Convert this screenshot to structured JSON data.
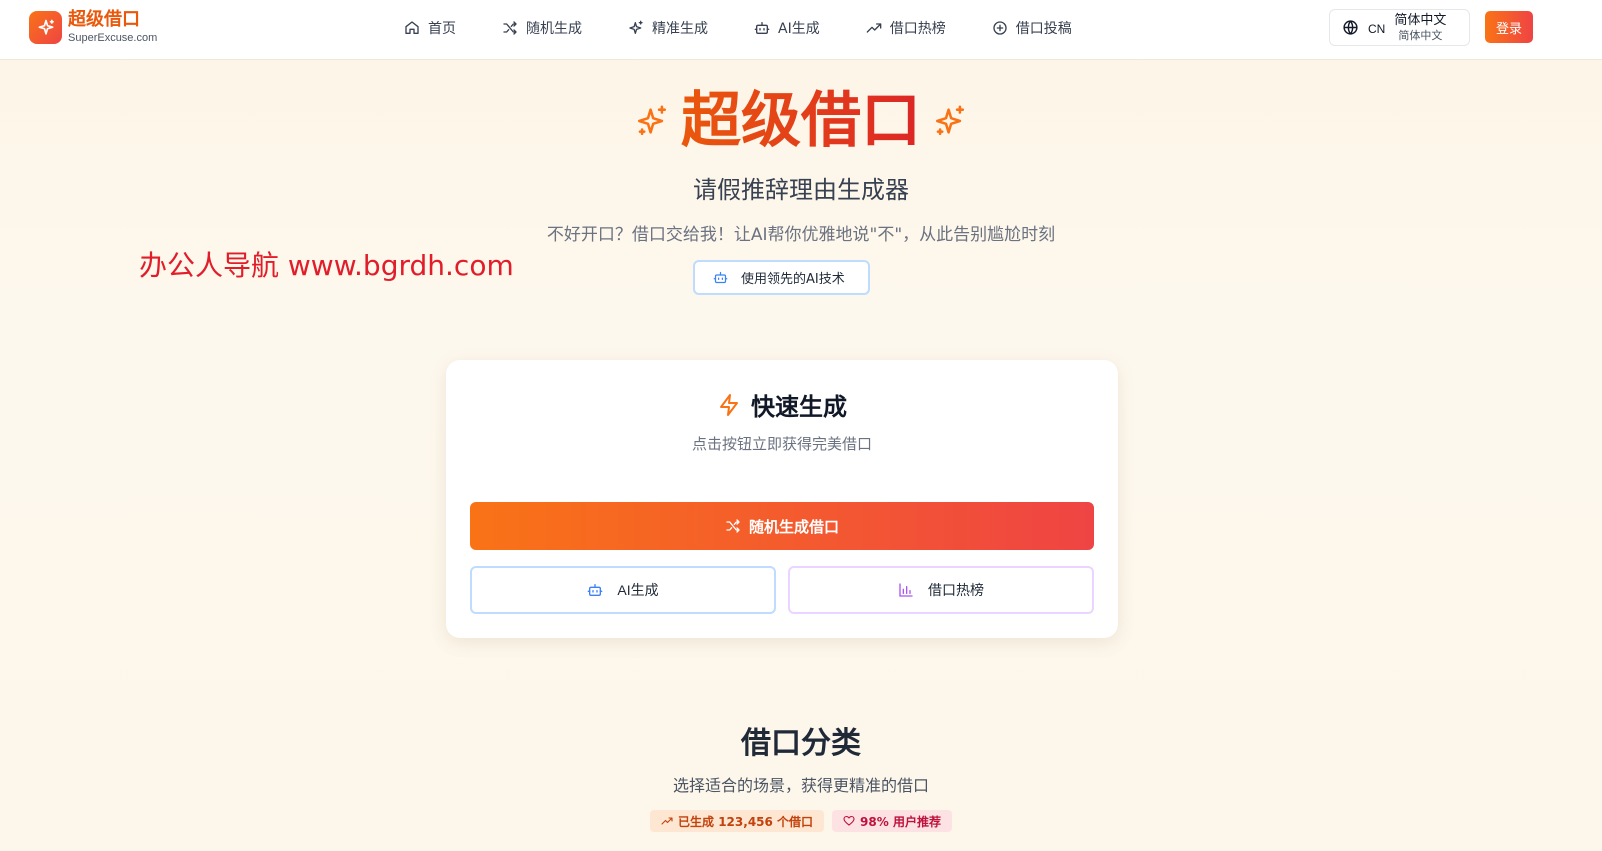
{
  "header": {
    "logo_title": "超级借口",
    "logo_sub": "SuperExcuse.com",
    "nav": [
      {
        "label": "首页",
        "icon": "home-icon"
      },
      {
        "label": "随机生成",
        "icon": "shuffle-icon"
      },
      {
        "label": "精准生成",
        "icon": "sparkles-icon"
      },
      {
        "label": "AI生成",
        "icon": "bot-icon"
      },
      {
        "label": "借口热榜",
        "icon": "trending-up-icon"
      },
      {
        "label": "借口投稿",
        "icon": "plus-circle-icon"
      }
    ],
    "lang_code": "CN",
    "lang_main": "简体中文",
    "lang_sub": "简体中文",
    "login_label": "登录"
  },
  "hero": {
    "title": "超级借口",
    "subtitle": "请假推辞理由生成器",
    "description": "不好开口？借口交给我！让AI帮你优雅地说\"不\"，从此告别尴尬时刻",
    "badge": "使用领先的AI技术"
  },
  "watermark": "办公人导航  www.bgrdh.com",
  "card": {
    "title": "快速生成",
    "description": "点击按钮立即获得完美借口",
    "primary_label": "随机生成借口",
    "ai_label": "AI生成",
    "hot_label": "借口热榜"
  },
  "categories": {
    "title": "借口分类",
    "description": "选择适合的场景，获得更精准的借口",
    "stat_generated": "已生成 123,456 个借口",
    "stat_recommend": "98% 用户推荐"
  },
  "colors": {
    "accent_orange": "#f97316",
    "accent_red": "#ef4444"
  }
}
